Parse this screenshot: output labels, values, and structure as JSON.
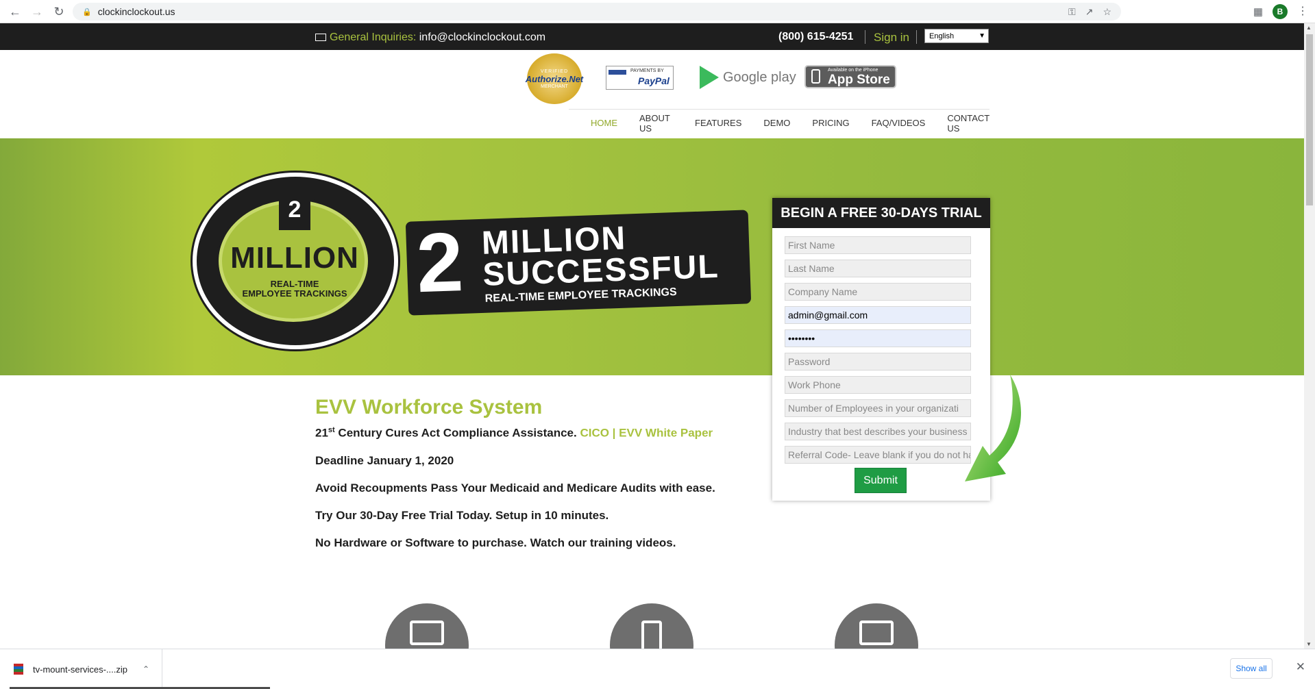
{
  "browser": {
    "url": "clockinclockout.us",
    "profile_initial": "B"
  },
  "topbar": {
    "inquiries_label": "General Inquiries:",
    "email": "info@clockinclockout.com",
    "phone": "(800) 615-4251",
    "signin": "Sign in",
    "language": "English"
  },
  "badges": {
    "authorize_top": "VERIFIED",
    "authorize_main": "Authorize.Net",
    "authorize_bottom": "MERCHANT",
    "paypal_top": "PAYMENTS BY",
    "paypal_main": "PayPal",
    "google_play": "Google play",
    "appstore_top": "Available on the iPhone",
    "appstore_main": "App Store"
  },
  "nav": {
    "items": [
      "HOME",
      "ABOUT US",
      "FEATURES",
      "DEMO",
      "PRICING",
      "FAQ/VIDEOS",
      "CONTACT US"
    ],
    "active": "HOME"
  },
  "hero": {
    "seal_number": "2",
    "seal_million": "MILLION",
    "seal_sub_1": "REAL-TIME",
    "seal_sub_2": "EMPLOYEE TRACKINGS",
    "banner_number": "2",
    "banner_million": "MILLION",
    "banner_successful": "SUCCESSFUL",
    "banner_sub": "REAL-TIME EMPLOYEE TRACKINGS"
  },
  "trial_form": {
    "title": "BEGIN A FREE 30-DAYS TRIAL",
    "first_name_placeholder": "First Name",
    "last_name_placeholder": "Last Name",
    "company_placeholder": "Company Name",
    "email_value": "admin@gmail.com",
    "password_value": "••••••••",
    "password_placeholder": "Password",
    "phone_placeholder": "Work Phone",
    "employees_placeholder": "Number of Employees in your organizati",
    "industry_placeholder": "Industry that best describes your business",
    "referral_placeholder": "Referral Code- Leave blank if you do not ha",
    "submit": "Submit"
  },
  "content": {
    "heading": "EVV Workforce System",
    "line1_prefix": "21",
    "line1_sup": "st",
    "line1_text": " Century Cures Act Compliance Assistance. ",
    "line1_link": "CICO | EVV White Paper",
    "line2": "Deadline January 1, 2020",
    "line3": "Avoid Recoupments Pass Your Medicaid and Medicare Audits with ease.",
    "line4": "Try Our 30-Day Free Trial Today. Setup in 10 minutes.",
    "line5": "No Hardware or Software to purchase. Watch our training videos."
  },
  "downloads": {
    "file": "tv-mount-services-....zip",
    "show_all": "Show all"
  },
  "colors": {
    "accent_green": "#a9c23f",
    "dark": "#1e1e1e",
    "submit_green": "#1f9c44"
  }
}
